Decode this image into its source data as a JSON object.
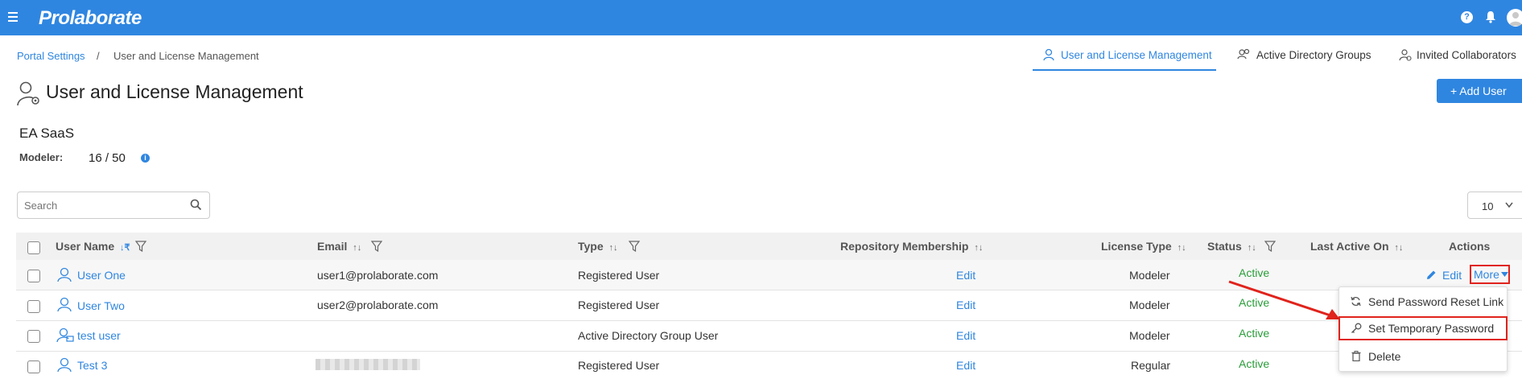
{
  "app": {
    "brand": "Prolaborate"
  },
  "breadcrumb": {
    "parent": "Portal Settings",
    "separator": "/",
    "current": "User and License Management"
  },
  "tabs": [
    {
      "label": "User and License Management",
      "active": true
    },
    {
      "label": "Active Directory Groups",
      "active": false
    },
    {
      "label": "Invited Collaborators",
      "active": false
    }
  ],
  "page": {
    "title": "User and License Management",
    "add_user_label": "+ Add User"
  },
  "license": {
    "edition": "EA SaaS",
    "modeler_label": "Modeler:",
    "modeler_count": "16 / 50"
  },
  "search": {
    "placeholder": "Search"
  },
  "page_size": {
    "value": "10"
  },
  "table": {
    "columns": {
      "user_name": "User Name",
      "email": "Email",
      "type": "Type",
      "repository": "Repository Membership",
      "license_type": "License Type",
      "status": "Status",
      "last_active": "Last Active On",
      "actions": "Actions"
    },
    "rows": [
      {
        "name": "User One",
        "email": "user1@prolaborate.com",
        "type": "Registered User",
        "repo": "Edit",
        "license": "Modeler",
        "status": "Active"
      },
      {
        "name": "User Two",
        "email": "user2@prolaborate.com",
        "type": "Registered User",
        "repo": "Edit",
        "license": "Modeler",
        "status": "Active"
      },
      {
        "name": "test user",
        "email": "",
        "type": "Active Directory Group User",
        "repo": "Edit",
        "license": "Modeler",
        "status": "Active"
      },
      {
        "name": "Test 3",
        "email": "",
        "type": "Registered User",
        "repo": "Edit",
        "license": "Regular",
        "status": "Active"
      }
    ],
    "row_actions": {
      "edit": "Edit",
      "more": "More"
    }
  },
  "more_menu": {
    "items": [
      {
        "label": "Send Password Reset Link",
        "icon": "refresh-icon"
      },
      {
        "label": "Set Temporary Password",
        "icon": "key-icon"
      },
      {
        "label": "Delete",
        "icon": "trash-icon"
      }
    ]
  },
  "colors": {
    "brand": "#2f86e0",
    "status_active": "#2a9d3a",
    "highlight": "#e0231c"
  }
}
